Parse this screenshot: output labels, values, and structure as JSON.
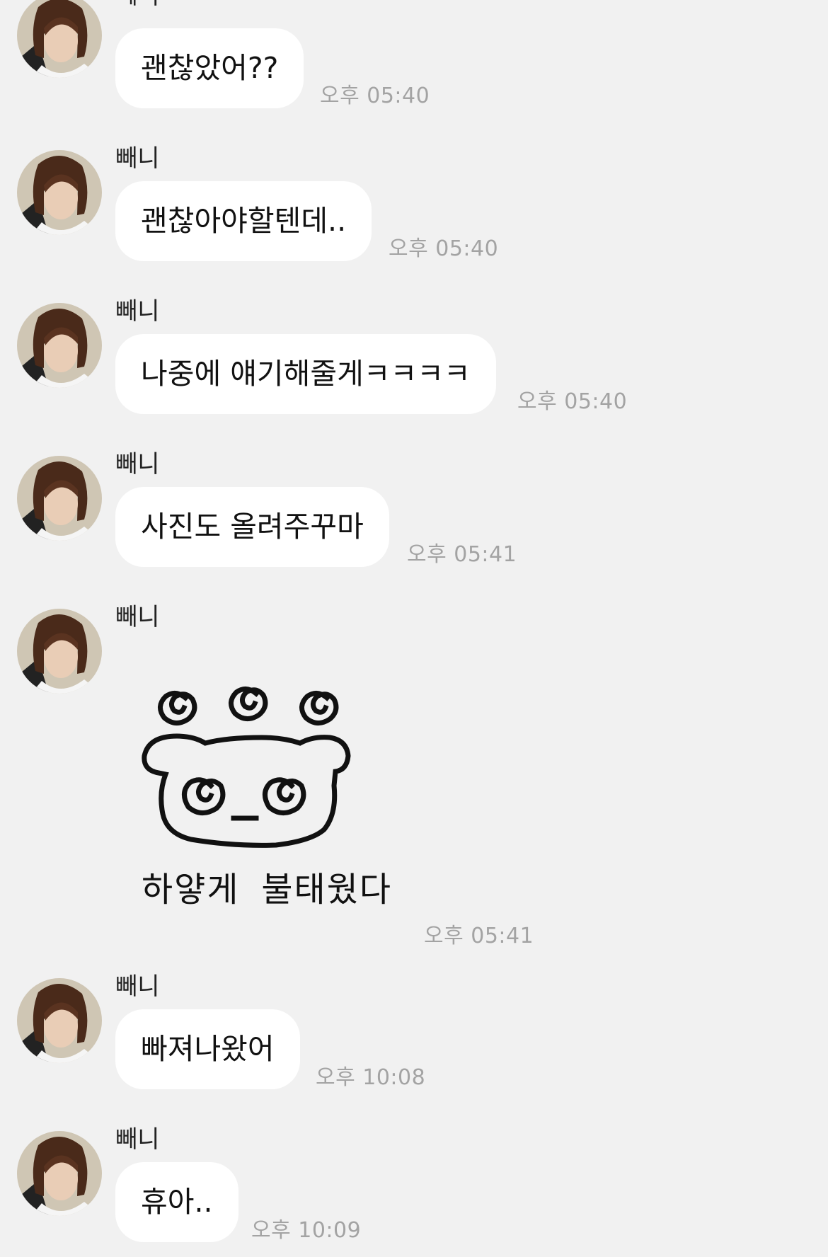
{
  "conversation": {
    "messages": [
      {
        "sender": "빼니",
        "text": "괜찮았어??",
        "time": "오후 05:40"
      },
      {
        "sender": "빼니",
        "text": "괜찮아야할텐데..",
        "time": "오후 05:40"
      },
      {
        "sender": "빼니",
        "text": "나중에 얘기해줄게ㅋㅋㅋㅋ",
        "time": "오후 05:40"
      },
      {
        "sender": "빼니",
        "text": "사진도 올려주꾸마",
        "time": "오후 05:41"
      },
      {
        "sender": "빼니",
        "sticker_caption": "하얗게 불태웠다",
        "time": "오후 05:41"
      },
      {
        "sender": "빼니",
        "text": "빠져나왔어",
        "time": "오후 10:08"
      },
      {
        "sender": "빼니",
        "text": "휴아..",
        "time": "오후 10:09"
      }
    ]
  },
  "icons": {
    "avatar": "profile-photo",
    "sticker": "dizzy-bear-sticker"
  },
  "colors": {
    "background": "#f1f1f1",
    "bubble": "#ffffff",
    "timestamp": "#a3a3a3",
    "text": "#111111"
  }
}
